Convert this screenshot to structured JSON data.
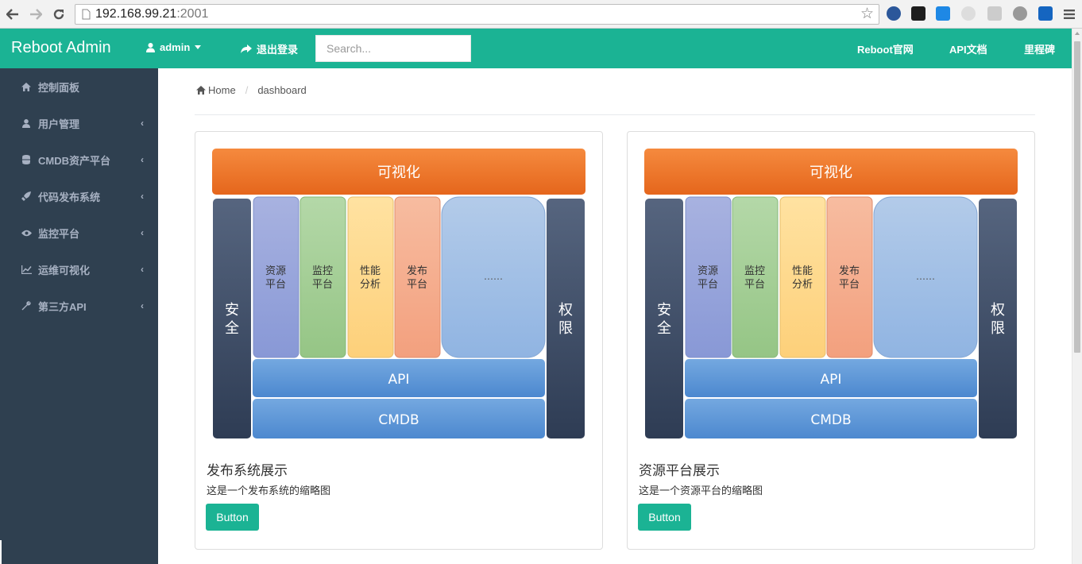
{
  "browser": {
    "url_host": "192.168.99.21",
    "url_port": ":2001"
  },
  "navbar": {
    "brand": "Reboot Admin",
    "user": "admin",
    "logout": "退出登录",
    "search_placeholder": "Search...",
    "links": [
      "Reboot官网",
      "API文档",
      "里程碑"
    ],
    "bg_color": "#1bb394"
  },
  "sidebar": {
    "bg_color": "#2f4050",
    "items": [
      {
        "label": "控制面板",
        "icon": "home-icon"
      },
      {
        "label": "用户管理",
        "icon": "user-icon"
      },
      {
        "label": "CMDB资产平台",
        "icon": "database-icon"
      },
      {
        "label": "代码发布系统",
        "icon": "rocket-icon"
      },
      {
        "label": "监控平台",
        "icon": "eye-icon"
      },
      {
        "label": "运维可视化",
        "icon": "chart-icon"
      },
      {
        "label": "第三方API",
        "icon": "wrench-icon"
      }
    ]
  },
  "breadcrumb": {
    "home": "Home",
    "current": "dashboard"
  },
  "diagram": {
    "top": "可视化",
    "left": "安全",
    "right": "权限",
    "modules": [
      "资源平台",
      "监控平台",
      "性能分析",
      "发布平台"
    ],
    "more": "……",
    "api": "API",
    "cmdb": "CMDB"
  },
  "cards": [
    {
      "title": "发布系统展示",
      "text": "这是一个发布系统的缩略图",
      "button": "Button"
    },
    {
      "title": "资源平台展示",
      "text": "这是一个资源平台的缩略图",
      "button": "Button"
    }
  ]
}
